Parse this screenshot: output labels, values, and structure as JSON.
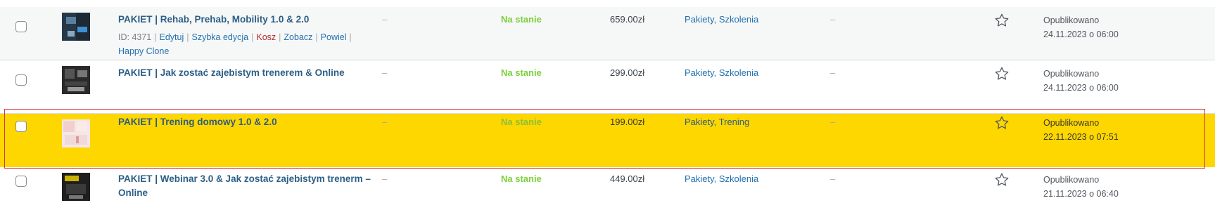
{
  "colors": {
    "highlight_row": "#fed600",
    "highlight_border": "#d63638",
    "in_stock": "#7ad03a",
    "link": "#2271b1"
  },
  "rows": [
    {
      "name": "PAKIET | Rehab, Prehab, Mobility 1.0 & 2.0",
      "row_actions": {
        "id_label": "ID: 4371",
        "edit": "Edytuj",
        "quick_edit": "Szybka edycja",
        "trash": "Kosz",
        "view": "Zobacz",
        "duplicate": "Powiel",
        "happy_clone": "Happy Clone"
      },
      "sku": "–",
      "stock": "Na stanie",
      "price": "659.00zł",
      "categories": "Pakiety, Szkolenia",
      "tags": "–",
      "featured_icon": "star-outline-icon",
      "status": "Opublikowano",
      "date": "24.11.2023 o 06:00"
    },
    {
      "name": "PAKIET | Jak zostać zajebistym trenerem & Online",
      "sku": "–",
      "stock": "Na stanie",
      "price": "299.00zł",
      "categories": "Pakiety, Szkolenia",
      "tags": "–",
      "featured_icon": "star-outline-icon",
      "status": "Opublikowano",
      "date": "24.11.2023 o 06:00"
    },
    {
      "name": "PAKIET | Trening domowy 1.0 & 2.0",
      "sku": "–",
      "stock": "Na stanie",
      "price": "199.00zł",
      "categories": "Pakiety, Trening",
      "tags": "–",
      "featured_icon": "star-outline-icon",
      "status": "Opublikowano",
      "date": "22.11.2023 o 07:51"
    },
    {
      "name": "PAKIET | Webinar 3.0 & Jak zostać zajebistym trenerm – Online",
      "sku": "–",
      "stock": "Na stanie",
      "price": "449.00zł",
      "categories": "Pakiety, Szkolenia",
      "tags": "–",
      "featured_icon": "star-outline-icon",
      "status": "Opublikowano",
      "date": "21.11.2023 o 06:40"
    }
  ]
}
